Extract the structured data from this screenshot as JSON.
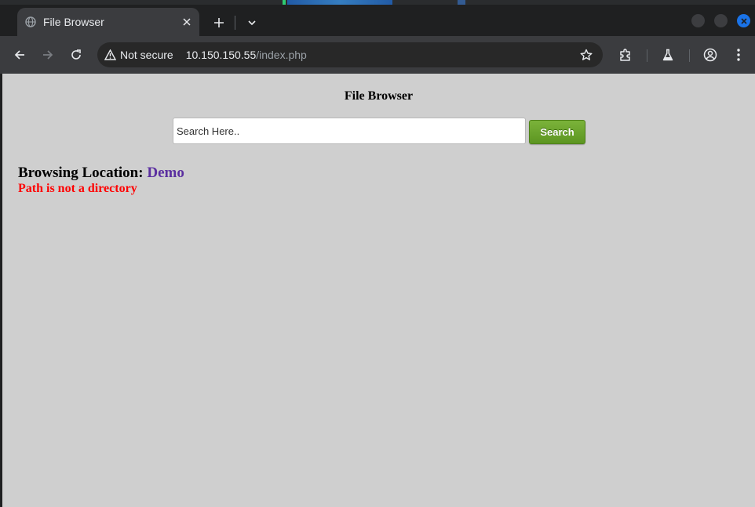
{
  "browser": {
    "tab_title": "File Browser",
    "security_label": "Not secure",
    "url_host": "10.150.150.55",
    "url_path": "/index.php"
  },
  "page": {
    "title": "File Browser",
    "search_placeholder": "Search Here..",
    "search_button": "Search",
    "location_label": "Browsing Location:",
    "location_value": "Demo",
    "error_message": "Path is not a directory"
  },
  "icons": {
    "tab_favicon": "globe-icon",
    "tab_close": "close-icon",
    "new_tab": "plus-icon",
    "tab_list": "chevron-down-icon",
    "back": "arrow-left-icon",
    "forward": "arrow-right-icon",
    "reload": "reload-icon",
    "warning": "warning-triangle-icon",
    "bookmark": "star-icon",
    "extensions": "puzzle-icon",
    "labs": "flask-icon",
    "profile": "profile-icon",
    "menu": "kebab-menu-icon"
  },
  "colors": {
    "page_background": "#cfcfcf",
    "search_button": "#6aa52c",
    "location_link": "#5b2fa0",
    "error_text": "#ff0000",
    "close_window": "#1a73e8"
  }
}
